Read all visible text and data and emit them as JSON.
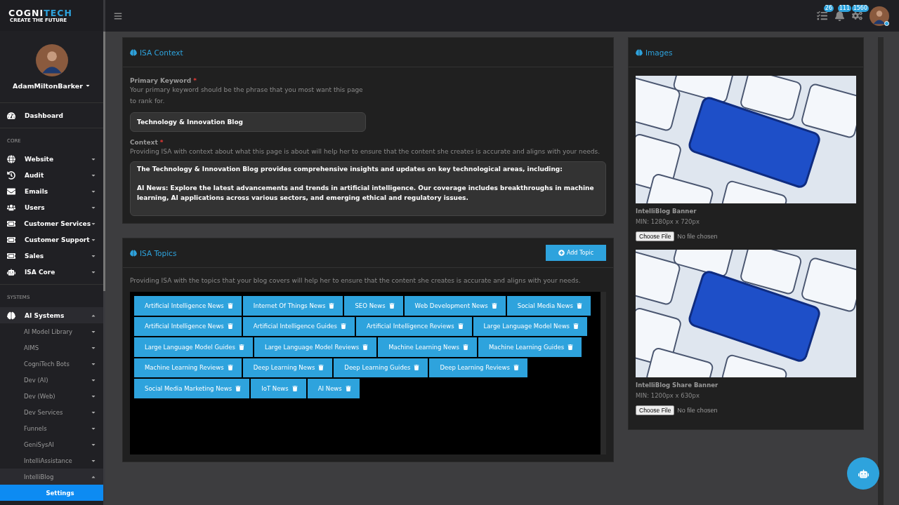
{
  "brand": {
    "name_first": "COGNI",
    "name_second": "TECH",
    "tagline": "CREATE THE FUTURE"
  },
  "topbar": {
    "badges": [
      {
        "count": "26"
      },
      {
        "count": "111"
      },
      {
        "count": "1560"
      }
    ],
    "user_online": true
  },
  "sidebar": {
    "user": {
      "name": "AdamMiltonBarker"
    },
    "sections": [
      {
        "items": [
          {
            "label": "Dashboard",
            "selected": false
          }
        ]
      },
      {
        "heading": "CORE",
        "items": [
          {
            "label": "Website",
            "selected": false,
            "expanded": false
          },
          {
            "label": "Audit",
            "selected": false,
            "expanded": false
          },
          {
            "label": "Emails",
            "selected": false,
            "expanded": false
          },
          {
            "label": "Users",
            "selected": false,
            "expanded": false
          },
          {
            "label": "Customer Services",
            "selected": false,
            "expanded": false
          },
          {
            "label": "Customer Support",
            "selected": false,
            "expanded": false
          },
          {
            "label": "Sales",
            "selected": false,
            "expanded": false
          },
          {
            "label": "ISA Core",
            "selected": false,
            "expanded": false
          }
        ]
      },
      {
        "heading": "SYSTEMS",
        "items": [
          {
            "label": "AI Systems",
            "selected": false,
            "expanded": true,
            "children": [
              {
                "label": "AI Model Library",
                "selected": false,
                "expanded": false
              },
              {
                "label": "AIMS",
                "selected": false,
                "expanded": false
              },
              {
                "label": "CogniTech Bots",
                "selected": false,
                "expanded": false
              },
              {
                "label": "Dev (AI)",
                "selected": false,
                "expanded": false
              },
              {
                "label": "Dev (Web)",
                "selected": false,
                "expanded": false
              },
              {
                "label": "Dev Services",
                "selected": false,
                "expanded": false
              },
              {
                "label": "Funnels",
                "selected": false,
                "expanded": false
              },
              {
                "label": "GeniSysAI",
                "selected": false,
                "expanded": false
              },
              {
                "label": "IntelliAssistance",
                "selected": false,
                "expanded": false
              },
              {
                "label": "IntelliBlog",
                "selected": false,
                "expanded": true,
                "children": [
                  {
                    "label": "Settings",
                    "selected": true
                  }
                ]
              }
            ]
          }
        ]
      }
    ]
  },
  "context_panel": {
    "title": "ISA Context",
    "keyword": {
      "label": "Primary Keyword",
      "required_mark": "*",
      "help": "Your primary keyword should be the phrase that you most want this page to rank for.",
      "value": "Technology & Innovation Blog"
    },
    "context": {
      "label": "Context",
      "required_mark": "*",
      "help": "Providing ISA with context about what this page is about will help her to ensure that the content she creates is accurate and aligns with your needs.",
      "value": "The Technology & Innovation Blog provides comprehensive insights and updates on key technological areas, including:\n\nAI News: Explore the latest advancements and trends in artificial intelligence. Our coverage includes breakthroughs in machine learning, AI applications across various sectors, and emerging ethical and regulatory issues."
    }
  },
  "topics_panel": {
    "title": "ISA Topics",
    "add_button": "Add Topic",
    "help": "Providing ISA with the topics that your blog covers will help her to ensure that the content she creates is accurate and aligns with your needs.",
    "topics": [
      "Artificial Intelligence News",
      "Internet Of Things News",
      "SEO News",
      "Web Development News",
      "Social Media News",
      "Artificial Intelligence News",
      "Artificial Intelligence Guides",
      "Artificial Intelligence Reviews",
      "Large Language Model News",
      "Large Language Model Guides",
      "Large Language Model Reviews",
      "Machine Learning News",
      "Machine Learning Guides",
      "Machine Learning Reviews",
      "Deep Learning News",
      "Deep Learning Guides",
      "Deep Learning Reviews",
      "Social Media Marketing News",
      "IoT News",
      "AI News"
    ]
  },
  "images_panel": {
    "title": "Images",
    "images": [
      {
        "kind": "picture",
        "label": "IntelliBlog Banner",
        "size": "MIN: 1280px x 720px",
        "button": "Choose File",
        "file_status": "No file chosen"
      },
      {
        "kind": "picture",
        "label": "IntelliBlog Share Banner",
        "size": "MIN: 1200px x 630px",
        "button": "Choose File",
        "file_status": "No file chosen"
      }
    ]
  }
}
